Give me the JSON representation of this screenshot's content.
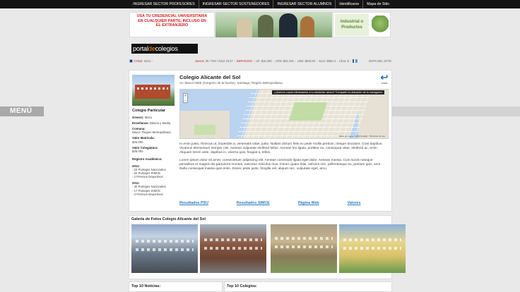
{
  "topbar": {
    "links": [
      "INGRESAR SECTOR PROFESORES",
      "INGRESAR SECTOR SOSTENEDORES",
      "INGRESAR SECTOR ALUMNOS",
      "Identificarse",
      "Mapa de Sitio"
    ]
  },
  "banners": {
    "left_text": "USA TU CREDENCIAL UNIVERSITARIA EN CUALQUIER PARTE, INCLUSO EN EL EXTRANJERO",
    "right_text": "Industrial o Productos"
  },
  "logo": {
    "part1": "portal",
    "part2": "de",
    "part3": "colegios"
  },
  "infobar": {
    "country": "CHILE",
    "home": "Inicio ›",
    "day": "Jueves",
    "date": "09 / Feb / 2012 16:27",
    "services": "SERVICIOS",
    "uf": "UF: $16.300",
    "utm": "UTM: $32.235",
    "usd": "USD: $530.02",
    "euro": "Euro: $550.3",
    "libra": "Libra: $",
    "site_map": "MAPA DEL SITIO"
  },
  "menu": {
    "label": "MENÚ"
  },
  "school": {
    "name": "Colegio Alicante del Sol",
    "address": "Av. Macul 2555 (Gregorio de la fuente), Santiago, Región Metropolitana",
    "back_label": "volver",
    "type": "Colegio Particular",
    "genero_label": "Genero:",
    "genero": "Mixto",
    "ensenanza_label": "Enseñanza:",
    "ensenanza": "Básica y Media",
    "comuna_label": "Comuna:",
    "comuna": "Macul, Region Metropolitana",
    "matricula_label": "Valor Matricula:",
    "matricula": "$25.000",
    "colegiatura_label": "Valor Colegiatura:",
    "colegiatura": "$45.000",
    "registro_label": "Registro Académico:",
    "y2012": "2012:",
    "y2012_items": [
      "- 23 Puntajes Nacionales",
      "- 20 Puntajes SIMCE",
      "- 2 Premios Deportivos"
    ],
    "y2011": "2011:",
    "y2011_items": [
      "- 30 Puntajes Nacionales",
      "- 17 Puntajes SIMCE",
      "- 4 Premios Deportivos"
    ]
  },
  "map": {
    "tooltip": "¿Quieres cosas interesantes a tu alrededor ahora? Comparte la ubicación de tu navegador",
    "copyright": "Datos de mapa ©2012 Google · Términos de uso"
  },
  "description": {
    "p1": "In enim justo, rhoncus ut, imperdiet a, venenatis vitae, justo. Nullam dictum felis eu pede mollis pretium. Integer tincidunt. Cras dapibus. Vivamus elementum semper nisi. Aenean vulputate eleifend tellus. Aenean leo ligula, porttitor eu, consequat vitae, eleifend ac, enim. Aliquam lorem ante, dapibus in, viverra quis, feugiat a, tellus.",
    "p2": "Lorem ipsum dolor sit amet, consectetuer adipiscing elit. Aenean commodo ligula eget dolor. Aenean massa. Cum sociis natoque penatibus et magnis dis parturient montes, nascetur ridiculus mus. Donec quam felis, ultricies nec, pellentesque eu, pretium quis, sem. Nulla consequat massa quis enim. Donec pede justo, fringilla vel, aliquet nec, vulputate eget, arcu."
  },
  "tabs": [
    "Resultados PSU",
    "Resultados SIMCE",
    "Página Web",
    "Valores"
  ],
  "gallery": {
    "title": "Galería de Fotos Colegio Alicante del Sol"
  },
  "bottom": {
    "top_noticias": "Top 10 Noticias:",
    "top_colegios": "Top 10 Colegios:"
  }
}
